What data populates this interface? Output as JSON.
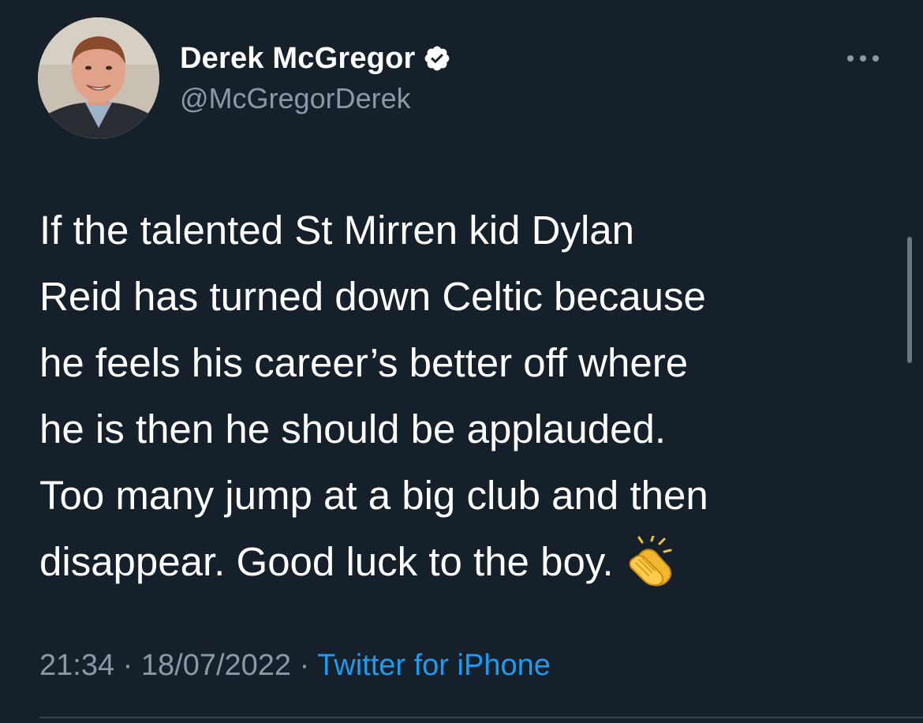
{
  "tweet": {
    "author": {
      "display_name": "Derek McGregor",
      "handle": "@McGregorDerek",
      "verified": true,
      "avatar_icon": "avatar-photo"
    },
    "text": "If the talented St Mirren kid Dylan\nReid has turned down Celtic because\nhe feels his career’s better off where\nhe is then he should be applauded.\nToo many jump at a big club and then\ndisappear. Good luck to the boy.",
    "emoji": "clapping-hands-icon",
    "time": "21:34",
    "date": "18/07/2022",
    "separator": " · ",
    "source": "Twitter for iPhone",
    "colors": {
      "background": "#15202b",
      "text": "#ffffff",
      "secondary": "#8b98a5",
      "link": "#1d9bf0",
      "verified_badge": "#ffffff"
    }
  }
}
